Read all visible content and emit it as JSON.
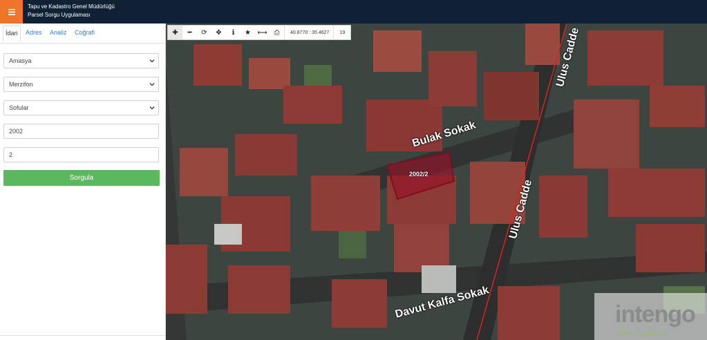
{
  "header": {
    "title_line1": "Tapu ve Kadastro Genel Müdürlüğü",
    "title_line2": "Parsel Sorgu Uygulaması",
    "menu_icon": "hamburger-icon",
    "accent": "#f0752a",
    "bg": "#0f2235"
  },
  "sidebar": {
    "tabs": [
      {
        "label": "İdari"
      },
      {
        "label": "Adres"
      },
      {
        "label": "Analiz"
      },
      {
        "label": "Coğrafi"
      }
    ],
    "province": "Amasya",
    "district": "Merzifon",
    "neighborhood": "Sofular",
    "block": "2002",
    "parcel": "2",
    "submit_label": "Sorgula",
    "submit_color": "#5cb85c"
  },
  "map": {
    "toolbar": [
      "plus-icon",
      "minus-icon",
      "refresh-icon",
      "locate-icon",
      "info-icon",
      "star-icon",
      "measure-icon",
      "print-icon"
    ],
    "coords": "40.8770 : 35.4627",
    "zoom": "19",
    "streets": [
      "Bulak Sokak",
      "Ulus Cadde",
      "Ulus Cadde",
      "Davut Kalfa Sokak"
    ],
    "parcel_label": "2002/2",
    "watermark": "intengo",
    "watermark_sub": "innovative solutions"
  }
}
